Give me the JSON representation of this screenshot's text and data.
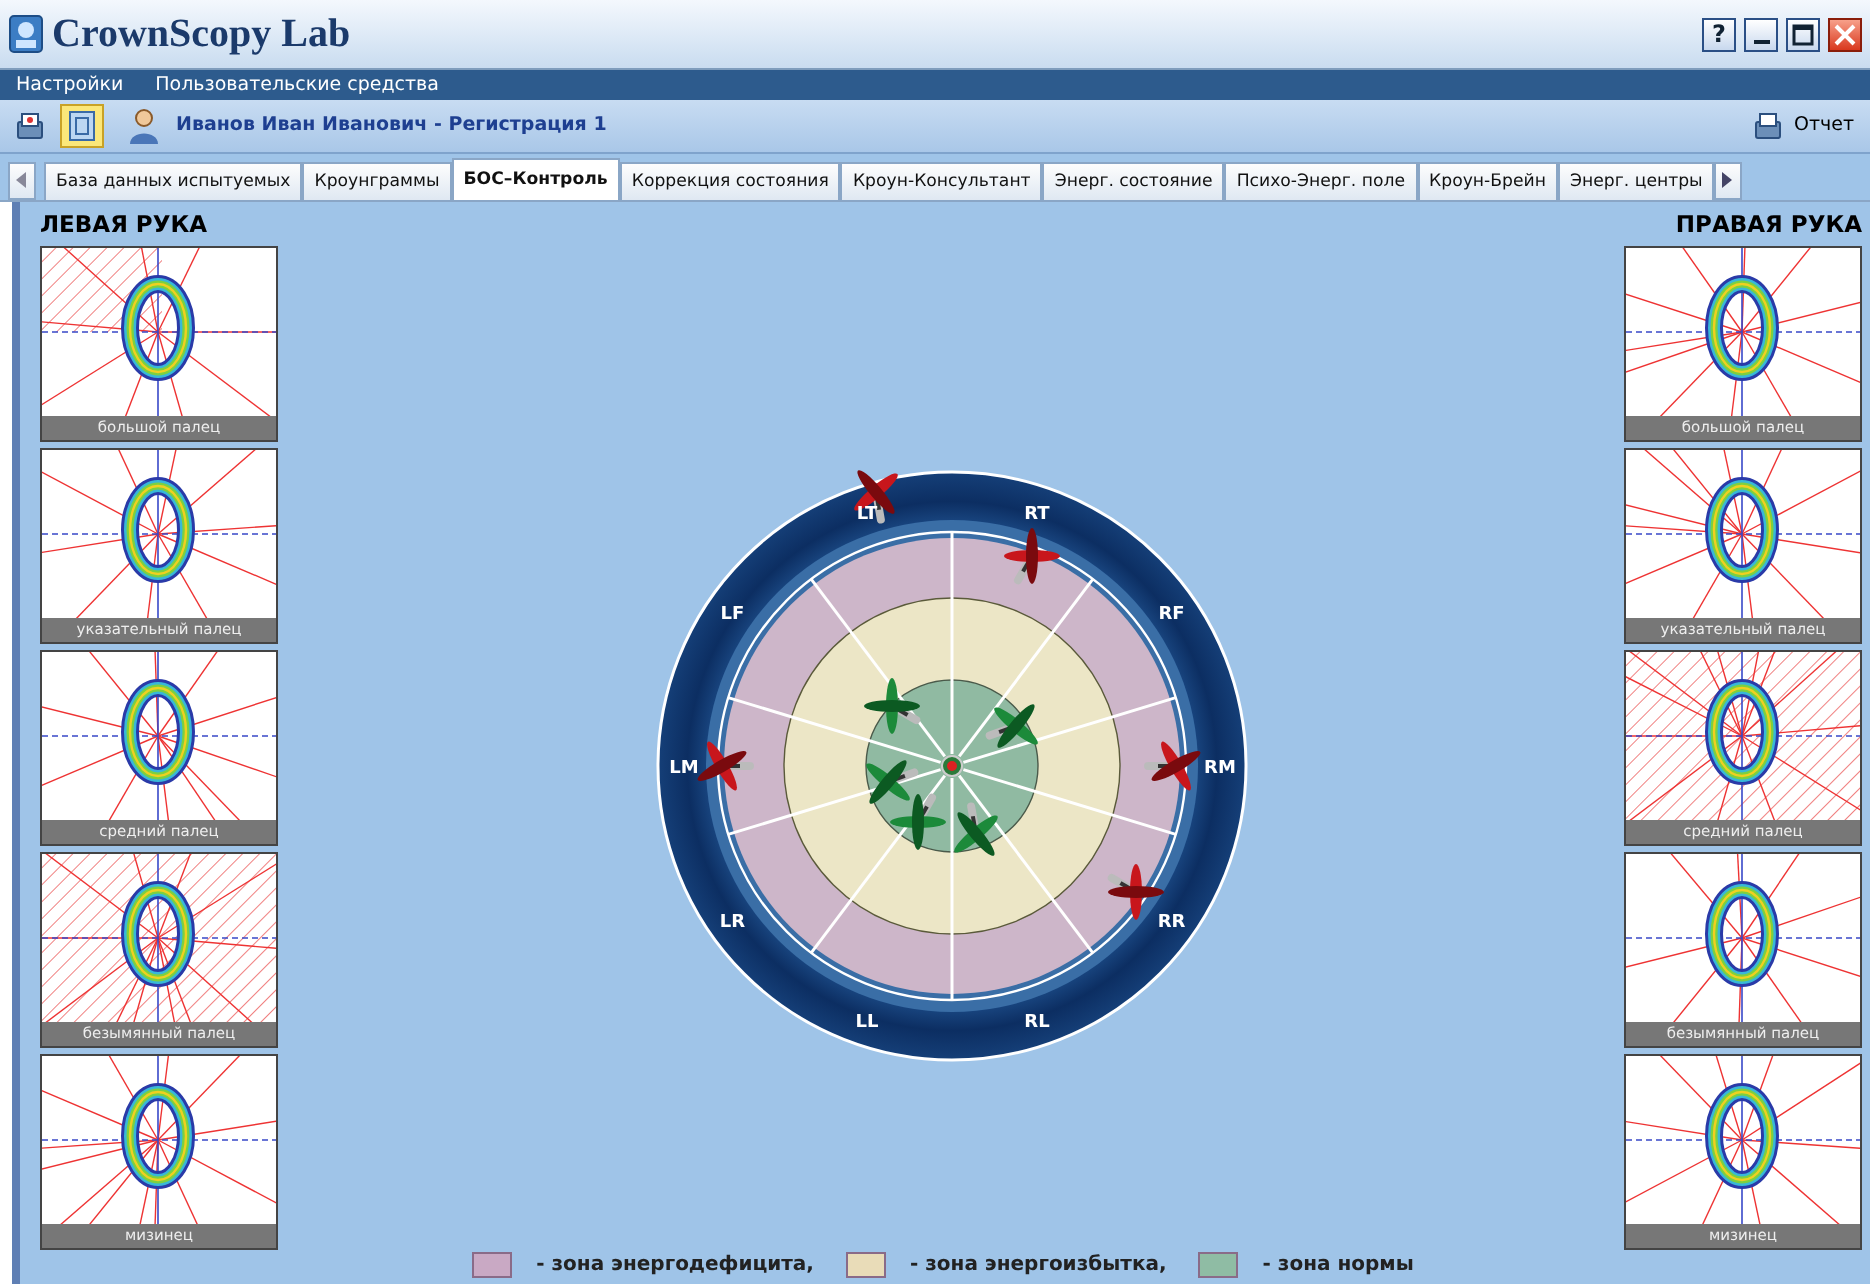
{
  "window": {
    "title": "CrownScopy Lab",
    "controls": [
      "?"
    ]
  },
  "menu": [
    "Настройки",
    "Пользовательские средства"
  ],
  "toolbar": {
    "tools": [
      {
        "selected": false
      },
      {
        "selected": true
      }
    ],
    "patient": "Иванов Иван Иванович - Регистрация 1",
    "report": "Отчет"
  },
  "tabs": [
    {
      "label": "База данных испытуемых",
      "selected": false
    },
    {
      "label": "Кроунграммы",
      "selected": false
    },
    {
      "label": "БОС–Контроль",
      "selected": true
    },
    {
      "label": "Коррекция состояния",
      "selected": false
    },
    {
      "label": "Кроун-Консультант",
      "selected": false
    },
    {
      "label": "Энерг. состояние",
      "selected": false
    },
    {
      "label": "Психо-Энерг. поле",
      "selected": false
    },
    {
      "label": "Кроун-Брейн",
      "selected": false
    },
    {
      "label": "Энерг. центры",
      "selected": false
    }
  ],
  "left_hand": {
    "title": "ЛЕВАЯ РУКА",
    "fingers": [
      "большой палец",
      "указательный палец",
      "средний палец",
      "безымянный палец",
      "мизинец"
    ]
  },
  "right_hand": {
    "title": "ПРАВАЯ РУКА",
    "fingers": [
      "большой палец",
      "указательный палец",
      "средний палец",
      "безымянный палец",
      "мизинец"
    ]
  },
  "target": {
    "sectors": [
      "RT",
      "RF",
      "RM",
      "RR",
      "RL",
      "LL",
      "LR",
      "LM",
      "LF",
      "LT"
    ]
  },
  "legend": [
    {
      "label": "- зона энергодефицита,",
      "color": "#c9a9c4"
    },
    {
      "label": "- зона энергоизбытка,",
      "color": "#e9dcb8"
    },
    {
      "label": "- зона нормы",
      "color": "#8fbca4"
    }
  ]
}
